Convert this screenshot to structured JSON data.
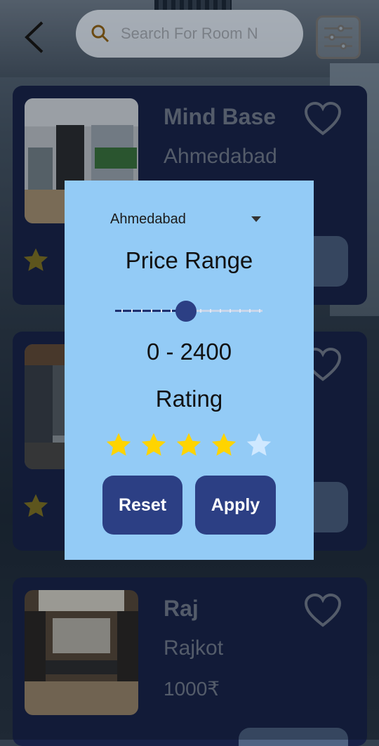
{
  "search": {
    "placeholder": "Search For Room N"
  },
  "icons": {
    "back": "back-arrow-icon",
    "search": "search-icon",
    "filter": "filter-sliders-icon",
    "favorite": "heart-icon",
    "star": "star-icon"
  },
  "colors": {
    "card_bg": "#172148",
    "modal_bg": "#93cbf6",
    "button_bg": "#2c3f84",
    "star_filled": "#ffd400",
    "star_empty": "#cfe8ff"
  },
  "cards": [
    {
      "title": "Mind Base",
      "city": "Ahmedabad",
      "price": ""
    },
    {
      "title": "",
      "city": "",
      "price": ""
    },
    {
      "title": "Raj",
      "city": "Rajkot",
      "price": "1000₹"
    }
  ],
  "filter": {
    "city": "Ahmedabad",
    "price_heading": "Price Range",
    "price_range": "0 - 2400",
    "price_slider_fraction": 0.48,
    "rating_heading": "Rating",
    "rating_value": 4,
    "rating_max": 5,
    "reset_label": "Reset",
    "apply_label": "Apply"
  }
}
